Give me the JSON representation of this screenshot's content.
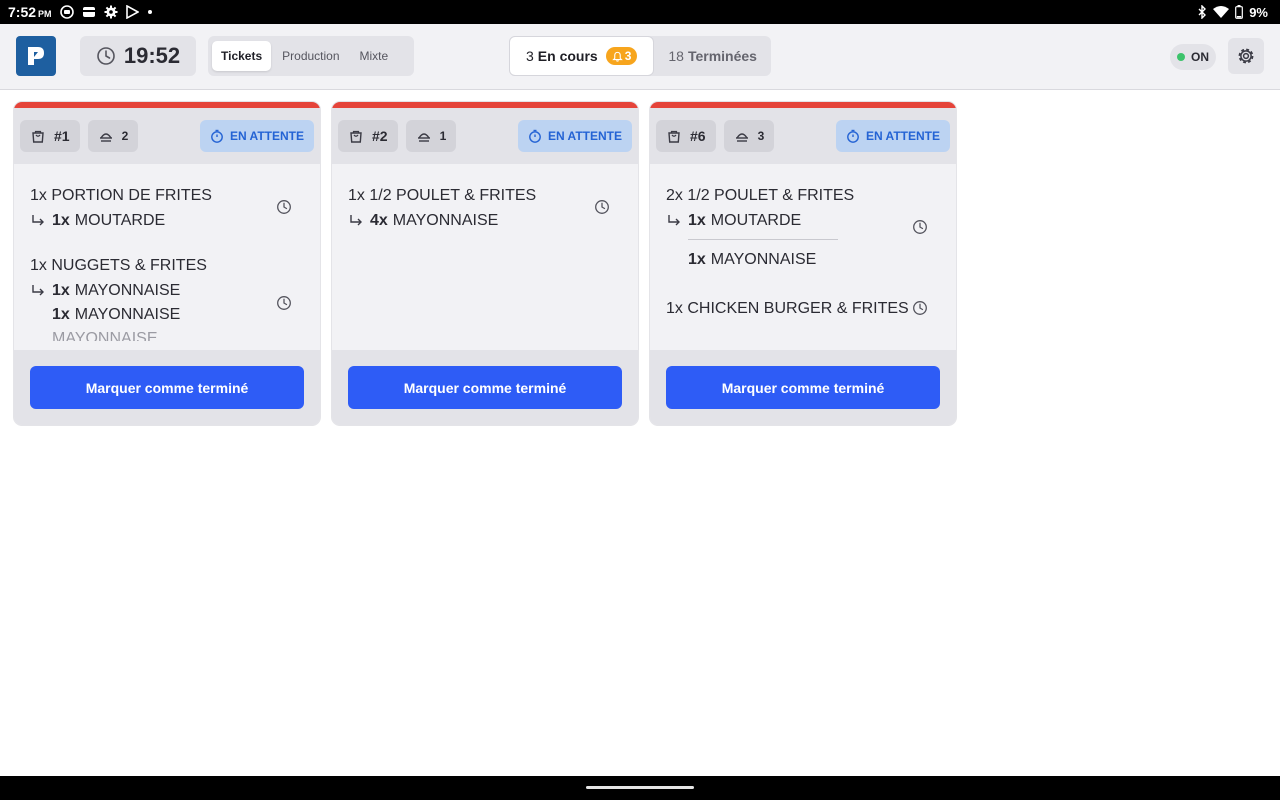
{
  "status_bar": {
    "time": "7:52",
    "ampm": "PM",
    "battery": "9%"
  },
  "header": {
    "clock": "19:52",
    "view_tabs": [
      {
        "label": "Tickets",
        "active": true
      },
      {
        "label": "Production",
        "active": false
      },
      {
        "label": "Mixte",
        "active": false
      }
    ],
    "status_tabs": {
      "in_progress_count": "3",
      "in_progress_label": "En cours",
      "alert_count": "3",
      "done_count": "18",
      "done_label": "Terminées"
    },
    "toggle_label": "ON"
  },
  "colors": {
    "accent": "#2e5cf6",
    "urgent": "#e5443a",
    "wait_bg": "#bcd3f2",
    "wait_text": "#2463d4",
    "alert": "#f7a51d",
    "online": "#3cc36b"
  },
  "tickets": [
    {
      "order": "#1",
      "covers": "2",
      "status": "EN ATTENTE",
      "items": [
        {
          "title": "1x PORTION DE FRITES",
          "mods": [
            {
              "qty": "1x",
              "name": "MOUTARDE"
            }
          ]
        },
        {
          "title": "1x NUGGETS & FRITES",
          "mods": [
            {
              "qty": "1x",
              "name": "MAYONNAISE"
            },
            {
              "qty": "1x",
              "name": "MAYONNAISE"
            }
          ],
          "overflow": "MAYONNAISE"
        }
      ],
      "button": "Marquer comme terminé"
    },
    {
      "order": "#2",
      "covers": "1",
      "status": "EN ATTENTE",
      "items": [
        {
          "title": "1x 1/2 POULET & FRITES",
          "mods": [
            {
              "qty": "4x",
              "name": "MAYONNAISE"
            }
          ]
        }
      ],
      "button": "Marquer comme terminé"
    },
    {
      "order": "#6",
      "covers": "3",
      "status": "EN ATTENTE",
      "items": [
        {
          "title": "2x 1/2 POULET & FRITES",
          "mods": [
            {
              "qty": "1x",
              "name": "MOUTARDE"
            },
            {
              "qty": "1x",
              "name": "MAYONNAISE"
            }
          ]
        },
        {
          "title": "1x CHICKEN BURGER & FRITES",
          "mods": []
        }
      ],
      "button": "Marquer comme terminé"
    }
  ]
}
